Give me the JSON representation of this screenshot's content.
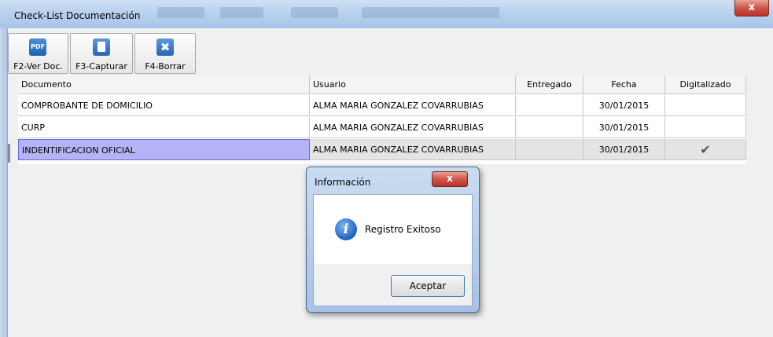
{
  "window": {
    "title": "Check-List Documentación",
    "close_label": "x"
  },
  "toolbar": {
    "view_label": "F2-Ver Doc.",
    "capture_label": "F3-Capturar",
    "delete_label": "F4-Borrar",
    "pdf_icon_text": "PDF"
  },
  "grid": {
    "headers": [
      "Documento",
      "Usuario",
      "Entregado",
      "Fecha",
      "Digitalizado"
    ],
    "rows": [
      {
        "documento": "COMPROBANTE DE DOMICILIO",
        "usuario": "ALMA MARIA GONZALEZ COVARRUBIAS",
        "entregado": "",
        "fecha": "30/01/2015",
        "digitalizado": ""
      },
      {
        "documento": "CURP",
        "usuario": "ALMA MARIA GONZALEZ COVARRUBIAS",
        "entregado": "",
        "fecha": "30/01/2015",
        "digitalizado": ""
      },
      {
        "documento": "INDENTIFICACION OFICIAL",
        "usuario": "ALMA MARIA GONZALEZ COVARRUBIAS",
        "entregado": "",
        "fecha": "30/01/2015",
        "digitalizado": "✔"
      }
    ]
  },
  "dialog": {
    "title": "Información",
    "close_label": "x",
    "message": "Registro Exitoso",
    "ok_label": "Aceptar"
  }
}
